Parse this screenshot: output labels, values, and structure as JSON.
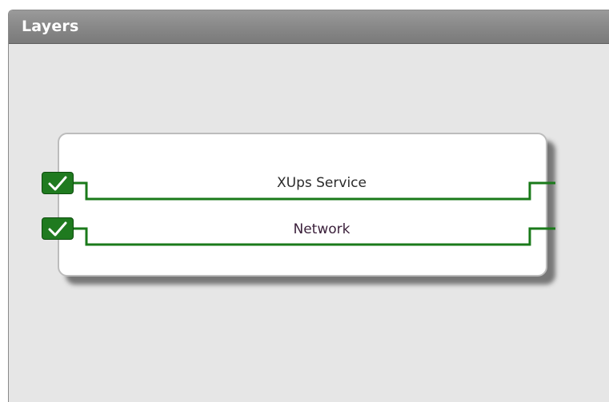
{
  "panel": {
    "title": "Layers"
  },
  "layers": [
    {
      "label": "XUps Service",
      "checked": true
    },
    {
      "label": "Network",
      "checked": true
    }
  ],
  "colors": {
    "accent": "#1f7a1f",
    "line": "#1a7a1a",
    "header": "#8a8a8a",
    "panel_bg": "#e6e6e6"
  }
}
